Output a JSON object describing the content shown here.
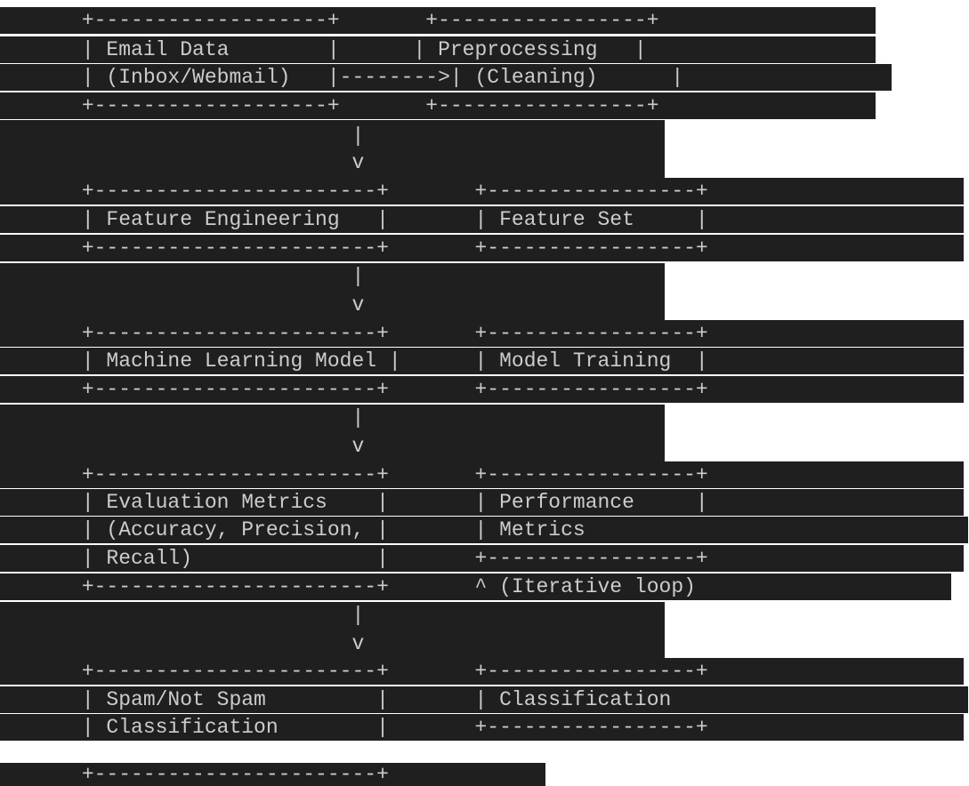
{
  "theme": {
    "background": "#ffffff",
    "highlight": "#1f1f1f",
    "text": "#cccccc"
  },
  "diagram": {
    "lines": [
      "      +-------------------+       +-----------------+",
      "      | Email Data        |      | Preprocessing   |",
      "      | (Inbox/Webmail)   |-------->| (Cleaning)      |",
      "      +-------------------+       +-----------------+",
      "                            |",
      "                            v",
      "      +-----------------------+       +-----------------+",
      "      | Feature Engineering   |       | Feature Set     |",
      "      +-----------------------+       +-----------------+",
      "                            |",
      "                            v",
      "      +-----------------------+       +-----------------+",
      "      | Machine Learning Model |      | Model Training  |",
      "      +-----------------------+       +-----------------+",
      "                            |",
      "                            v",
      "      +-----------------------+       +-----------------+",
      "      | Evaluation Metrics    |       | Performance     |",
      "      | (Accuracy, Precision, |       | Metrics",
      "      | Recall)               |       +-----------------+",
      "      +-----------------------+       ^ (Iterative loop)",
      "                            |",
      "                            v",
      "      +-----------------------+       +-----------------+",
      "      | Spam/Not Spam         |       | Classification",
      "      | Classification        |       +-----------------+",
      "      +-----------------------+"
    ]
  }
}
